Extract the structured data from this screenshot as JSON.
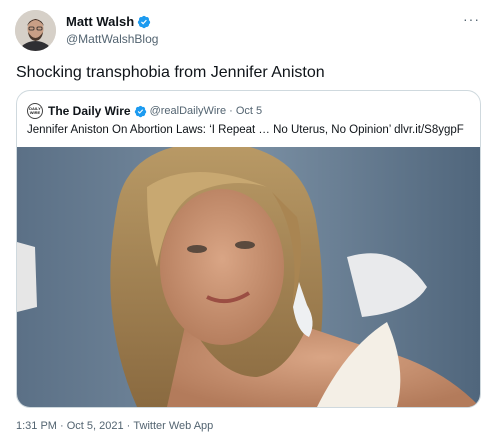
{
  "author": {
    "name": "Matt Walsh",
    "handle": "@MattWalshBlog"
  },
  "tweet": {
    "text": "Shocking transphobia from Jennifer Aniston"
  },
  "quoted": {
    "logo_text": "DAILY WIRE",
    "name": "The Daily Wire",
    "handle": "@realDailyWire",
    "separator": "·",
    "date": "Oct 5",
    "text": "Jennifer Aniston On Abortion Laws: ‘I Repeat … No Uterus, No Opinion’ dlvr.it/S8ygpF"
  },
  "footer": {
    "time": "1:31 PM",
    "sep1": " · ",
    "date": "Oct 5, 2021",
    "sep2": " · ",
    "source": "Twitter Web App"
  },
  "icons": {
    "verified": "verified-badge-icon",
    "more": "more-icon"
  },
  "colors": {
    "verified_blue": "#1d9bf0",
    "text": "#0f1419",
    "secondary": "#536471",
    "border": "#cfd9de"
  }
}
